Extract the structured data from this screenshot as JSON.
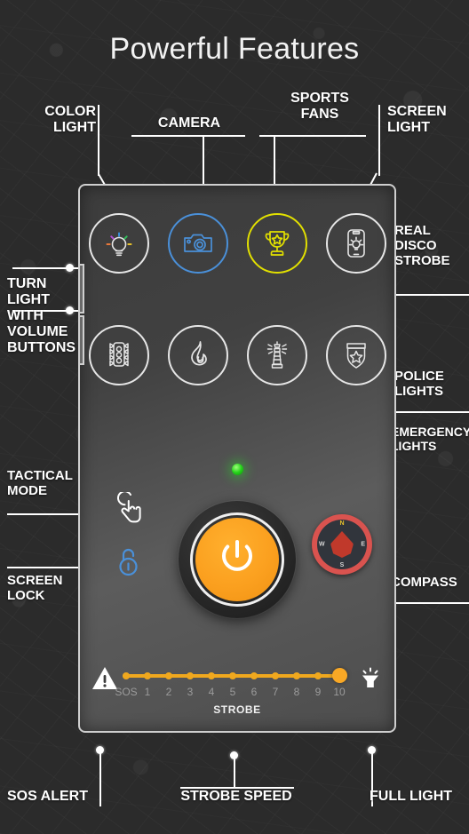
{
  "page": {
    "title": "Powerful Features",
    "background_color": "#2b2b2b",
    "accent_color": "#f9a825"
  },
  "callouts": {
    "color_light": "COLOR\nLIGHT",
    "camera": "CAMERA",
    "sports_fans": "SPORTS\nFANS",
    "screen_light": "SCREEN\nLIGHT",
    "real_disco_strobe": "REAL\nDISCO\nSTROBE",
    "police_lights": "POLICE\nLIGHTS",
    "emergency_lights": "EMERGENCY\nLIGHTS",
    "turn_light_volume": "TURN\nLIGHT\nWITH\nVOLUME\nBUTTONS",
    "tactical_mode": "TACTICAL\nMODE",
    "screen_lock": "SCREEN\nLOCK",
    "compass": "COMPASS",
    "sos_alert": "SOS ALERT",
    "strobe_speed": "STROBE SPEED",
    "full_light": "FULL LIGHT"
  },
  "phone": {
    "icon_row_1": [
      {
        "name": "color-light",
        "icon": "colored-bulb-icon",
        "color": "#e6e6e6"
      },
      {
        "name": "camera",
        "icon": "camera-icon",
        "color": "#4a90d9"
      },
      {
        "name": "sports-fans",
        "icon": "trophy-icon",
        "color": "#e2e000"
      },
      {
        "name": "screen-light",
        "icon": "phone-screen-light-icon",
        "color": "#e6e6e6"
      }
    ],
    "icon_row_2": [
      {
        "name": "traffic-light",
        "icon": "traffic-light-icon",
        "color": "#e6e6e6"
      },
      {
        "name": "fire",
        "icon": "flame-icon",
        "color": "#e6e6e6"
      },
      {
        "name": "lighthouse",
        "icon": "lighthouse-icon",
        "color": "#e6e6e6"
      },
      {
        "name": "police-badge",
        "icon": "shield-star-icon",
        "color": "#e6e6e6"
      }
    ],
    "status_led": {
      "name": "status-led",
      "color": "#25d21a",
      "state": "on"
    },
    "power_button": {
      "name": "power-button",
      "icon": "power-icon",
      "color": "#fba01f"
    },
    "tactical_icon": {
      "name": "tactical-hand-icon",
      "color": "#ffffff"
    },
    "lock_icon": {
      "name": "screen-lock-icon",
      "color": "#4a90d9"
    },
    "compass_widget": {
      "name": "compass-widget",
      "ring_color": "#d9534f",
      "dial_color": "#31353c",
      "needle_color": "#c0392b",
      "directions": [
        "N",
        "E",
        "S",
        "W"
      ],
      "north_color": "#e8c22a"
    },
    "slider": {
      "caption": "STROBE",
      "tick_labels": [
        "SOS",
        "1",
        "2",
        "3",
        "4",
        "5",
        "6",
        "7",
        "8",
        "9",
        "10"
      ],
      "value": "10",
      "track_color": "#f0a81e",
      "knob_color": "#f9a825",
      "left_icon": "warning-triangle-icon",
      "right_icon": "lamp-full-light-icon"
    },
    "volume_buttons": [
      "volume-up-button",
      "volume-down-button"
    ]
  }
}
